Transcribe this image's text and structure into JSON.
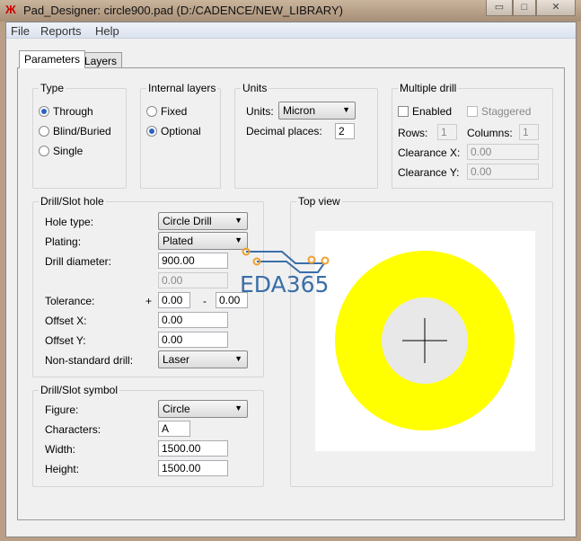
{
  "window": {
    "title": "Pad_Designer: circle900.pad (D:/CADENCE/NEW_LIBRARY)",
    "controls": {
      "minimize": "▭",
      "maximize": "□",
      "close": "✕"
    }
  },
  "menu": [
    "File",
    "Reports",
    "Help"
  ],
  "tabs": [
    "Parameters",
    "Layers"
  ],
  "type": {
    "label": "Type",
    "options": [
      "Through",
      "Blind/Buried",
      "Single"
    ],
    "selected": "Through"
  },
  "internal_layers": {
    "label": "Internal layers",
    "options": [
      "Fixed",
      "Optional"
    ],
    "selected": "Optional"
  },
  "units": {
    "label": "Units",
    "units_label": "Units:",
    "units_value": "Micron",
    "decimal_label": "Decimal places:",
    "decimal_value": "2"
  },
  "multiple_drill": {
    "label": "Multiple drill",
    "enabled": "Enabled",
    "staggered": "Staggered",
    "rows_label": "Rows:",
    "rows": "1",
    "columns_label": "Columns:",
    "columns": "1",
    "clearance_x_label": "Clearance X:",
    "clearance_x": "0.00",
    "clearance_y_label": "Clearance Y:",
    "clearance_y": "0.00"
  },
  "drill": {
    "label": "Drill/Slot hole",
    "hole_type_label": "Hole type:",
    "hole_type": "Circle Drill",
    "plating_label": "Plating:",
    "plating": "Plated",
    "diameter_label": "Drill diameter:",
    "diameter": "900.00",
    "diameter2": "0.00",
    "tolerance_label": "Tolerance:",
    "plus": "+",
    "tol_plus": "0.00",
    "minus": "-",
    "tol_minus": "0.00",
    "offset_x_label": "Offset X:",
    "offset_x": "0.00",
    "offset_y_label": "Offset Y:",
    "offset_y": "0.00",
    "nonstd_label": "Non-standard drill:",
    "nonstd": "Laser"
  },
  "symbol": {
    "label": "Drill/Slot symbol",
    "figure_label": "Figure:",
    "figure": "Circle",
    "characters_label": "Characters:",
    "characters": "A",
    "width_label": "Width:",
    "width": "1500.00",
    "height_label": "Height:",
    "height": "1500.00"
  },
  "top_view": {
    "label": "Top view",
    "pad_color": "#ffff00",
    "hole_color": "#e8e8e8"
  },
  "watermark": "EDA365"
}
